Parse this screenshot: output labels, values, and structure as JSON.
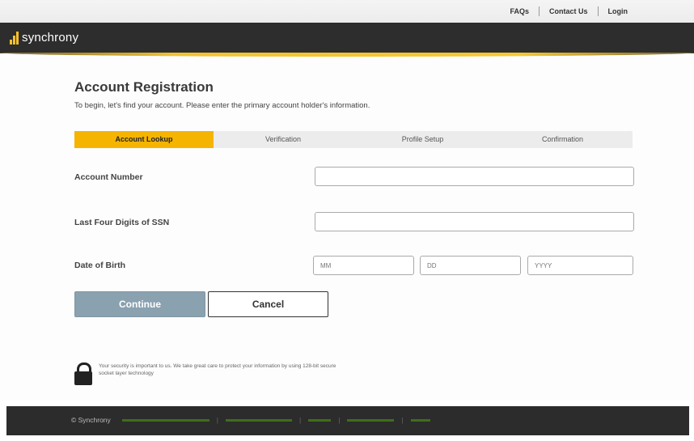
{
  "top_nav": {
    "faqs": "FAQs",
    "contact": "Contact Us",
    "login": "Login"
  },
  "brand": {
    "name": "synchrony"
  },
  "page": {
    "title": "Account Registration",
    "subtitle": "To begin, let's find your account. Please enter the primary account holder's information."
  },
  "steps": [
    {
      "label": "Account Lookup",
      "active": true
    },
    {
      "label": "Verification",
      "active": false
    },
    {
      "label": "Profile Setup",
      "active": false
    },
    {
      "label": "Confirmation",
      "active": false
    }
  ],
  "form": {
    "account_number_label": "Account Number",
    "account_number_value": "",
    "ssn_label": "Last Four Digits of SSN",
    "ssn_value": "",
    "dob_label": "Date of Birth",
    "dob_month_placeholder": "MM",
    "dob_day_placeholder": "DD",
    "dob_year_placeholder": "YYYY"
  },
  "buttons": {
    "continue": "Continue",
    "cancel": "Cancel"
  },
  "security": {
    "text": "Your security is important to us. We take great care to protect your information by using 128-bit secure socket layer technology"
  },
  "footer": {
    "copyright": "© Synchrony",
    "links": [
      "",
      "",
      "",
      "",
      ""
    ]
  },
  "colors": {
    "accent": "#f4b400",
    "brand_bar": "#2d2d2d",
    "continue_button": "#8aa1b0",
    "footer_link": "#4d8a1e"
  }
}
